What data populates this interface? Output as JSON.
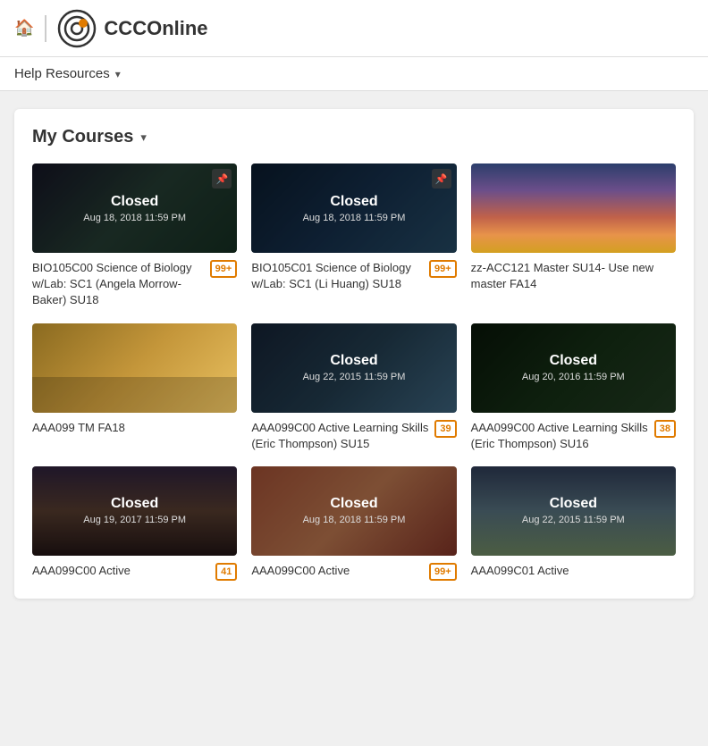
{
  "header": {
    "logo_text": "CCCOnline",
    "home_icon": "🏠",
    "dots_icon": "⋮"
  },
  "nav": {
    "help_resources_label": "Help Resources",
    "chevron": "▾"
  },
  "my_courses": {
    "title": "My Courses",
    "chevron": "▾",
    "courses": [
      {
        "id": "bio105c00",
        "title": "BIO105C00 Science of Biology w/Lab: SC1 (Angela Morrow-Baker) SU18",
        "badge": "99+",
        "closed": true,
        "closed_date": "Aug 18, 2018 11:59 PM",
        "pinned": true,
        "thumb_class": "thumb-bio1"
      },
      {
        "id": "bio105c01",
        "title": "BIO105C01 Science of Biology w/Lab: SC1 (Li Huang) SU18",
        "badge": "99+",
        "closed": true,
        "closed_date": "Aug 18, 2018 11:59 PM",
        "pinned": true,
        "thumb_class": "thumb-bio2"
      },
      {
        "id": "zz-acc121",
        "title": "zz-ACC121 Master SU14- Use new master FA14",
        "badge": "",
        "closed": false,
        "closed_date": "",
        "pinned": false,
        "thumb_class": "thumb-sunset"
      },
      {
        "id": "aaa099-tm",
        "title": "AAA099 TM FA18",
        "badge": "",
        "closed": false,
        "closed_date": "",
        "pinned": false,
        "thumb_class": "thumb-bridge"
      },
      {
        "id": "aaa099c00-su15",
        "title": "AAA099C00 Active Learning Skills (Eric Thompson) SU15",
        "badge": "39",
        "closed": true,
        "closed_date": "Aug 22, 2015 11:59 PM",
        "pinned": false,
        "thumb_class": "thumb-desert"
      },
      {
        "id": "aaa099c00-su16",
        "title": "AAA099C00 Active Learning Skills (Eric Thompson) SU16",
        "badge": "38",
        "closed": true,
        "closed_date": "Aug 20, 2016 11:59 PM",
        "pinned": false,
        "thumb_class": "thumb-tree"
      },
      {
        "id": "aaa099c00-su17",
        "title": "AAA099C00 Active",
        "badge": "41",
        "closed": true,
        "closed_date": "Aug 19, 2017 11:59 PM",
        "pinned": false,
        "thumb_class": "thumb-mountain"
      },
      {
        "id": "aaa099c00-su18",
        "title": "AAA099C00 Active",
        "badge": "99+",
        "closed": true,
        "closed_date": "Aug 18, 2018 11:59 PM",
        "pinned": false,
        "thumb_class": "thumb-students"
      },
      {
        "id": "aaa099c01",
        "title": "AAA099C01 Active",
        "badge": "",
        "closed": true,
        "closed_date": "Aug 22, 2015 11:59 PM",
        "pinned": false,
        "thumb_class": "thumb-road"
      }
    ]
  }
}
